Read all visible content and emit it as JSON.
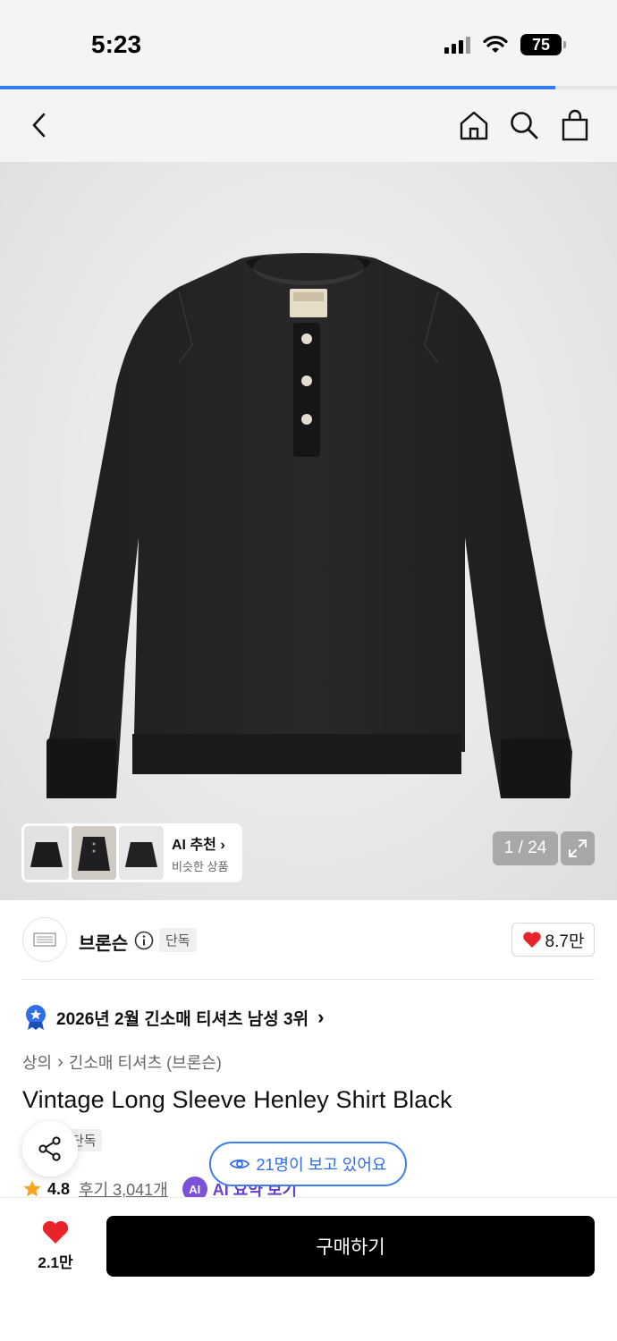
{
  "status_bar": {
    "time": "5:23",
    "battery": "75"
  },
  "page_loading": {
    "progress": 0.9
  },
  "nav": {
    "back": "back",
    "home": "home",
    "search": "search",
    "cart": "cart"
  },
  "gallery": {
    "ai_card": {
      "title": "AI 추천",
      "subtitle": "비슷한 상품"
    },
    "counter": "1 / 24"
  },
  "brand": {
    "name": "브론슨",
    "exclusive": "단독",
    "likes": "8.7만"
  },
  "ranking": {
    "text": "2026년 2월 긴소매 티셔츠 남성 3위"
  },
  "breadcrumb": {
    "category": "상의",
    "subcategory": "긴소매 티셔츠 (브론슨)"
  },
  "product": {
    "title": "Vintage Long Sleeve Henley Shirt Black",
    "tag": "단독",
    "rating": "4.8",
    "reviews": "후기 3,041개",
    "ai_badge": "AI",
    "ai_summary": "AI 요약 보기"
  },
  "viewers": {
    "text": "21명이 보고 있어요"
  },
  "bottom": {
    "wish_count": "2.1만",
    "buy_label": "구매하기"
  },
  "colors": {
    "accent_blue": "#2f7cf6",
    "heart_red": "#e8242b",
    "ai_purple": "#7b52d8",
    "buy_black": "#000000"
  }
}
